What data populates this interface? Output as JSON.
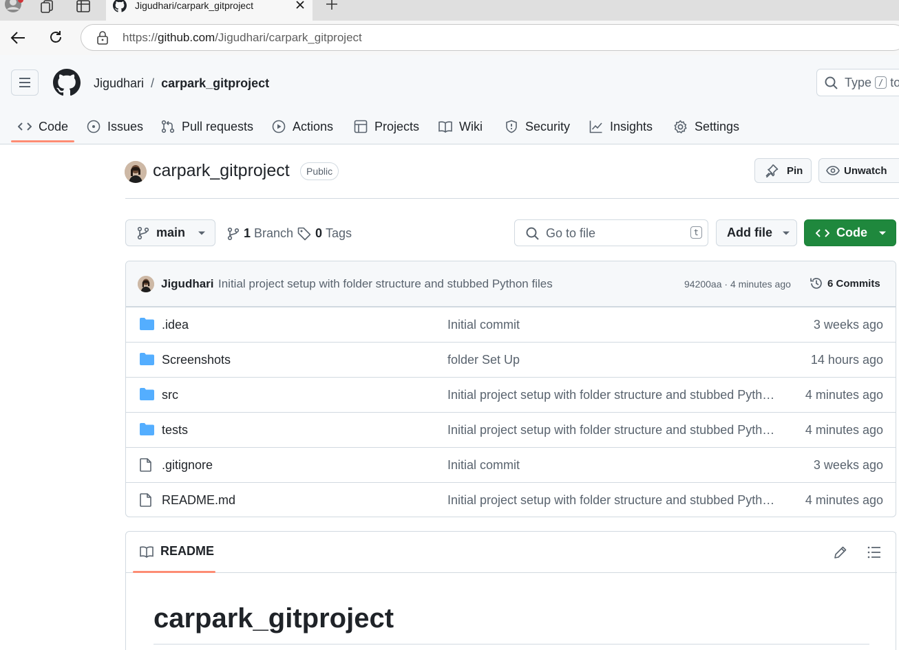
{
  "browser": {
    "tab_title": "Jigudhari/carpark_gitproject",
    "url_prefix": "https://",
    "url_host": "github.com",
    "url_path": "/Jigudhari/carpark_gitproject"
  },
  "header": {
    "owner": "Jigudhari",
    "separator": "/",
    "repo": "carpark_gitproject",
    "search_placeholder": "Type",
    "search_kbd": "/",
    "search_suffix": "to"
  },
  "nav": {
    "items": [
      {
        "label": "Code",
        "icon": "code-icon",
        "selected": true
      },
      {
        "label": "Issues",
        "icon": "issue-icon"
      },
      {
        "label": "Pull requests",
        "icon": "pull-request-icon"
      },
      {
        "label": "Actions",
        "icon": "play-icon"
      },
      {
        "label": "Projects",
        "icon": "table-icon"
      },
      {
        "label": "Wiki",
        "icon": "book-icon"
      },
      {
        "label": "Security",
        "icon": "shield-icon"
      },
      {
        "label": "Insights",
        "icon": "graph-icon"
      },
      {
        "label": "Settings",
        "icon": "gear-icon"
      }
    ]
  },
  "repo": {
    "name": "carpark_gitproject",
    "visibility": "Public",
    "pin_label": "Pin",
    "watch_label": "Unwatch"
  },
  "toolbar": {
    "branch": "main",
    "branch_count": "1",
    "branch_label": "Branch",
    "tag_count": "0",
    "tag_label": "Tags",
    "goto_placeholder": "Go to file",
    "goto_kbd": "t",
    "add_file": "Add file",
    "code": "Code"
  },
  "latest_commit": {
    "author": "Jigudhari",
    "message": "Initial project setup with folder structure and stubbed Python files",
    "meta": "94200aa · 4 minutes ago",
    "commit_count": "6 Commits"
  },
  "files": [
    {
      "name": ".idea",
      "type": "folder",
      "message": "Initial commit",
      "age": "3 weeks ago"
    },
    {
      "name": "Screenshots",
      "type": "folder",
      "message": "folder Set Up",
      "age": "14 hours ago"
    },
    {
      "name": "src",
      "type": "folder",
      "message": "Initial project setup with folder structure and stubbed Python files",
      "age": "4 minutes ago"
    },
    {
      "name": "tests",
      "type": "folder",
      "message": "Initial project setup with folder structure and stubbed Python files",
      "age": "4 minutes ago"
    },
    {
      "name": ".gitignore",
      "type": "file",
      "message": "Initial commit",
      "age": "3 weeks ago"
    },
    {
      "name": "README.md",
      "type": "file",
      "message": "Initial project setup with folder structure and stubbed Python files",
      "age": "4 minutes ago"
    }
  ],
  "readme": {
    "tab_label": "README",
    "heading": "carpark_gitproject"
  },
  "colors": {
    "accent_underline": "#fd8c73",
    "code_button": "#1f883d",
    "folder": "#54aeff"
  }
}
